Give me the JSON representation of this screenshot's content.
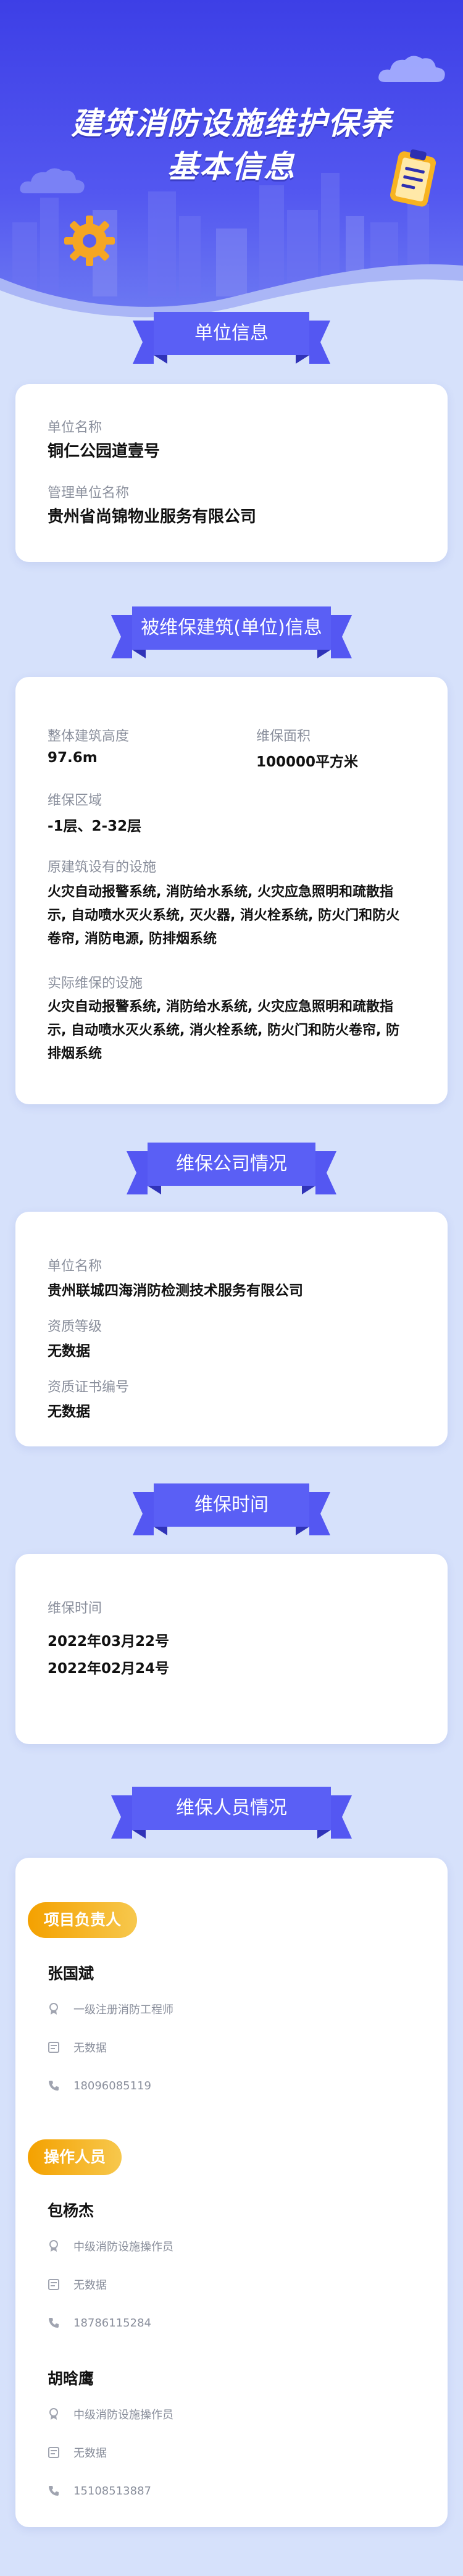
{
  "header": {
    "title_line1": "建筑消防设施维护保养",
    "title_line2": "基本信息"
  },
  "unit_section": {
    "heading": "单位信息",
    "unit_name_label": "单位名称",
    "unit_name": "铜仁公园道壹号",
    "mgmt_label": "管理单位名称",
    "mgmt_name": "贵州省尚锦物业服务有限公司"
  },
  "building_section": {
    "heading": "被维保建筑(单位)信息",
    "height_label": "整体建筑高度",
    "height_value": "97.6m",
    "area_label": "维保面积",
    "area_value": "100000平方米",
    "region_label": "维保区域",
    "region_value": "-1层、2-32层",
    "original_label": "原建筑设有的设施",
    "original_lines": [
      "火灾自动报警系统, 消防给水系统, 火灾应急照明和疏散指",
      "示, 自动喷水灭火系统, 灭火器, 消火栓系统, 防火门和防火",
      "卷帘, 消防电源, 防排烟系统"
    ],
    "actual_label": "实际维保的设施",
    "actual_lines": [
      "火灾自动报警系统, 消防给水系统, 火灾应急照明和疏散指",
      "示, 自动喷水灭火系统, 消火栓系统, 防火门和防火卷帘, 防",
      "排烟系统"
    ]
  },
  "company_section": {
    "heading": "维保公司情况",
    "name_label": "单位名称",
    "name_value": "贵州联城四海消防检测技术服务有限公司",
    "grade_label": "资质等级",
    "grade_value": "无数据",
    "cert_label": "资质证书编号",
    "cert_value": "无数据"
  },
  "time_section": {
    "heading": "维保时间",
    "label": "维保时间",
    "date1": "2022年03月22号",
    "date2": "2022年02月24号"
  },
  "staff_section": {
    "heading": "维保人员情况",
    "leader_badge": "项目负责人",
    "leader": {
      "name": "张国斌",
      "cert": "一级注册消防工程师",
      "id": "无数据",
      "phone": "18096085119"
    },
    "operator_badge": "操作人员",
    "operators": [
      {
        "name": "包杨杰",
        "cert": "中级消防设施操作员",
        "id": "无数据",
        "phone": "18786115284"
      },
      {
        "name": "胡晗鹰",
        "cert": "中级消防设施操作员",
        "id": "无数据",
        "phone": "15108513887"
      }
    ]
  },
  "colors": {
    "primary": "#4b4ff0",
    "ribbon": "#5457f2",
    "ribbon_fold": "#3033b8",
    "page_bg": "#d6e1fb",
    "badge_from": "#f4a100",
    "badge_to": "#f7c84d",
    "gear": "#f5a623"
  },
  "icons": [
    "gear-icon",
    "clipboard-icon",
    "cloud-icon",
    "certificate-icon",
    "id-card-icon",
    "phone-icon"
  ]
}
